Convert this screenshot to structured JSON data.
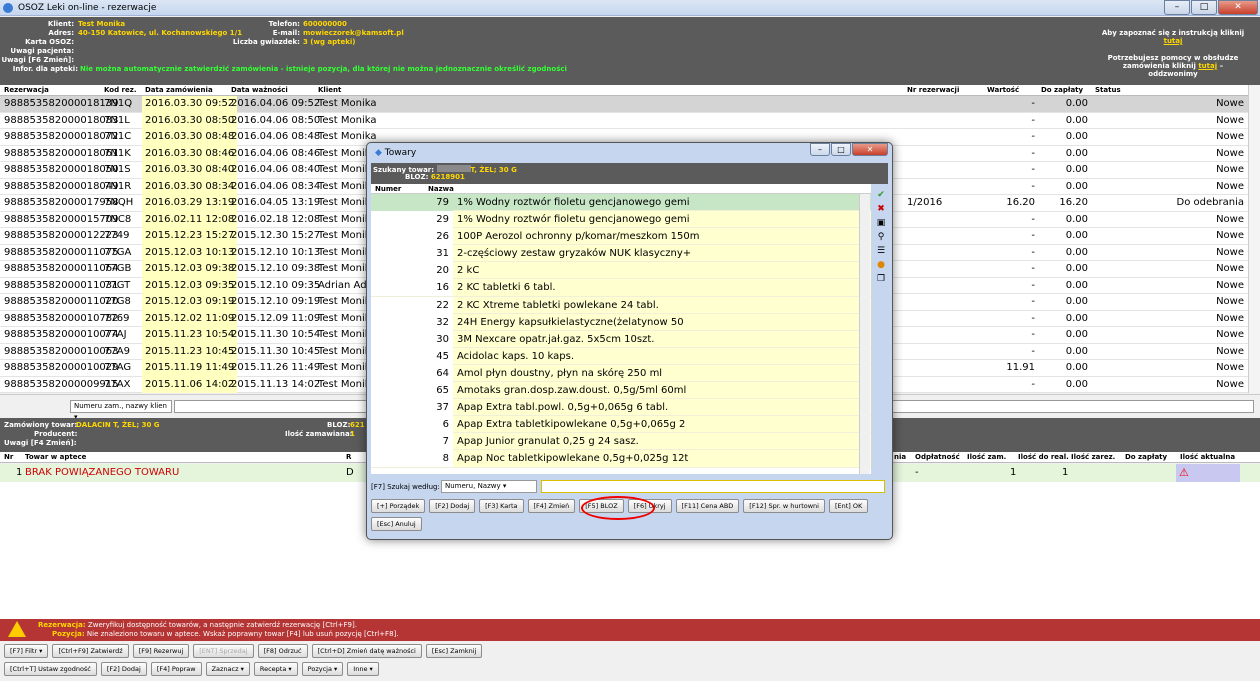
{
  "window": {
    "title": "OSOZ Leki on-line - rezerwacje"
  },
  "header": {
    "labels": {
      "klient": "Klient:",
      "adres": "Adres:",
      "karta": "Karta OSOZ:",
      "uwagi": "Uwagi pacjenta:",
      "uwagi_f6": "Uwagi [F6 Zmień]:",
      "infor": "Infor. dla apteki:",
      "telefon": "Telefon:",
      "email": "E-mail:",
      "liczba": "Liczba gwiazdek:"
    },
    "klient": "Test Monika",
    "adres": "40-150 Katowice, ul. Kochanowskiego 1/1",
    "telefon": "600000000",
    "email": "mowieczorek@kamsoft.pl",
    "liczba": "3 (wg apteki)",
    "infor": "Nie można automatycznie zatwierdzić zamówienia - istnieje pozycja, dla której nie można jednoznacznie określić zgodności",
    "help1": "Aby zapoznać się z instrukcją kliknij",
    "help1_link": "tutaj",
    "help2": "Potrzebujesz pomocy w obsłudze zamówienia kliknij",
    "help2_link": "tutaj",
    "help2_tail": "– oddzwonimy"
  },
  "table": {
    "columns": [
      "Rezerwacja",
      "Kod rez.",
      "Data zamówienia",
      "Data ważności",
      "Klient",
      "Nr rezerwacji",
      "Wartość",
      "Do zapłaty",
      "Status"
    ],
    "rows": [
      [
        "988853582000018139",
        "7N1Q",
        "2016.03.30 09:52",
        "2016.04.06 09:52",
        "Test Monika",
        "",
        "-",
        "0.00",
        "Nowe"
      ],
      [
        "988853582000018083",
        "7N1L",
        "2016.03.30 08:50",
        "2016.04.06 08:50",
        "Test Monika",
        "",
        "-",
        "0.00",
        "Nowe"
      ],
      [
        "988853582000018072",
        "7N1C",
        "2016.03.30 08:48",
        "2016.04.06 08:48",
        "Test Monika",
        "",
        "-",
        "0.00",
        "Nowe"
      ],
      [
        "988853582000018061",
        "7N1K",
        "2016.03.30 08:46",
        "2016.04.06 08:46",
        "Test Monik",
        "",
        "-",
        "0.00",
        "Nowe"
      ],
      [
        "988853582000018050",
        "7N1S",
        "2016.03.30 08:40",
        "2016.04.06 08:40",
        "Test Monik",
        "",
        "-",
        "0.00",
        "Nowe"
      ],
      [
        "988853582000018049",
        "7N1R",
        "2016.03.30 08:34",
        "2016.04.06 08:34",
        "Test Monik",
        "",
        "-",
        "0.00",
        "Nowe"
      ],
      [
        "988853582000017958",
        "7NQH",
        "2016.03.29 13:19",
        "2016.04.05 13:19",
        "Test Monik",
        "1/2016",
        "16.20",
        "16.20",
        "Do odebrania"
      ],
      [
        "988853582000015709",
        "7NC8",
        "2016.02.11 12:08",
        "2016.02.18 12:08",
        "Test Monik",
        "",
        "-",
        "0.00",
        "Nowe"
      ],
      [
        "988853582000012223",
        "7749",
        "2015.12.23 15:27",
        "2015.12.30 15:27",
        "Test Monik",
        "",
        "-",
        "0.00",
        "Nowe"
      ],
      [
        "988853582000011075",
        "77GA",
        "2015.12.03 10:13",
        "2015.12.10 10:13",
        "Test Monik",
        "",
        "-",
        "0.00",
        "Nowe"
      ],
      [
        "988853582000011064",
        "77GB",
        "2015.12.03 09:38",
        "2015.12.10 09:38",
        "Test Monik",
        "",
        "-",
        "0.00",
        "Nowe"
      ],
      [
        "988853582000011031",
        "77GT",
        "2015.12.03 09:35",
        "2015.12.10 09:35",
        "Adrian Adr",
        "",
        "-",
        "0.00",
        "Nowe"
      ],
      [
        "988853582000011020",
        "77G8",
        "2015.12.03 09:19",
        "2015.12.10 09:19",
        "Test Monik",
        "",
        "-",
        "0.00",
        "Nowe"
      ],
      [
        "988853582000010782",
        "7769",
        "2015.12.02 11:09",
        "2015.12.09 11:09",
        "Test Monik",
        "",
        "-",
        "0.00",
        "Nowe"
      ],
      [
        "988853582000010074",
        "77AJ",
        "2015.11.23 10:54",
        "2015.11.30 10:54",
        "Test Monik",
        "",
        "-",
        "0.00",
        "Nowe"
      ],
      [
        "988853582000010063",
        "77A9",
        "2015.11.23 10:45",
        "2015.11.30 10:45",
        "Test Monik",
        "",
        "-",
        "0.00",
        "Nowe"
      ],
      [
        "988853582000010029",
        "77AG",
        "2015.11.19 11:49",
        "2015.11.26 11:49",
        "Test Monik",
        "",
        "11.91",
        "0.00",
        "Nowe"
      ],
      [
        "988853582000009915",
        "77AX",
        "2015.11.06 14:02",
        "2015.11.13 14:02",
        "Test Monik",
        "",
        "-",
        "0.00",
        "Nowe"
      ]
    ]
  },
  "search_combo": "Numeru zam., nazwy klien",
  "bottom": {
    "labels": {
      "towar": "Zamówiony towar:",
      "producent": "Producent:",
      "uwagi": "Uwagi [F4 Zmień]:",
      "bloz": "BLOZ:",
      "ilosc": "Ilość zamawiana:"
    },
    "towar": "DALACIN T, ŻEL; 30 G",
    "bloz": "621",
    "ilosc": "1",
    "columns": [
      "Nr",
      "Towar w aptece",
      "R",
      "nia",
      "Odpłatność",
      "Ilość zam.",
      "Ilość do real.",
      "Ilość zarez.",
      "Do zapłaty",
      "Ilość aktualna"
    ],
    "row": {
      "nr": "1",
      "towar": "BRAK POWIĄZANEGO TOWARU",
      "r": "D",
      "odp": "-",
      "zam": "1",
      "real": "1"
    }
  },
  "alert": {
    "l1_label": "Rezerwacja:",
    "l1": "Zweryfikuj dostępność towarów, a następnie zatwierdź rezerwację [Ctrl+F9].",
    "l2_label": "Pozycja:",
    "l2": "Nie znaleziono towaru w aptece. Wskaż poprawny towar [F4] lub usuń pozycję [Ctrl+F8]."
  },
  "buttons1": [
    "[F7] Filtr ▾",
    "[Ctrl+F9] Zatwierdź",
    "[F9] Rezerwuj",
    "[ENT] Sprzedaj",
    "[F8] Odrzuć",
    "[Ctrl+D] Zmień datę ważności",
    "[Esc] Zamknij"
  ],
  "buttons2": [
    "[Ctrl+T] Ustaw zgodność",
    "[F2] Dodaj",
    "[F4] Popraw",
    "Zaznacz ▾",
    "Recepta ▾",
    "Pozycja ▾",
    "Inne ▾"
  ],
  "dialog": {
    "title": "Towary",
    "szukany_label": "Szukany towar:",
    "szukany": "T, ŻEL; 30 G",
    "bloz_label": "BLOZ:",
    "bloz": "6218901",
    "col_num": "Numer",
    "col_name": "Nazwa",
    "items": [
      [
        "79",
        "1% Wodny roztwór fioletu gencjanowego gemi"
      ],
      [
        "29",
        "1% Wodny roztwór fioletu gencjanowego gemi"
      ],
      [
        "26",
        "100P Aerozol ochronny p/komar/meszkom 150m"
      ],
      [
        "31",
        "2-częściowy zestaw gryzaków NUK klasyczny+"
      ],
      [
        "20",
        "2 kC"
      ],
      [
        "16",
        "2 KC tabletki 6 tabl."
      ],
      [
        "22",
        "2 KC Xtreme tabletki powlekane 24 tabl."
      ],
      [
        "32",
        "24H Energy kapsułkielastyczne(żelatynow 50"
      ],
      [
        "30",
        "3M Nexcare opatr.jał.gaz. 5x5cm 10szt."
      ],
      [
        "45",
        "Acidolac kaps. 10 kaps."
      ],
      [
        "64",
        "Amol płyn doustny, płyn na skórę 250 ml"
      ],
      [
        "65",
        "Amotaks gran.dosp.zaw.doust. 0,5g/5ml 60ml"
      ],
      [
        "37",
        "Apap Extra tabl.powl. 0,5g+0,065g 6 tabl."
      ],
      [
        "6",
        "Apap Extra tabletkipowlekane 0,5g+0,065g 2"
      ],
      [
        "7",
        "Apap Junior granulat 0,25 g 24 sasz."
      ],
      [
        "8",
        "Apap Noc tabletkipowlekane 0,5g+0,025g 12t"
      ]
    ],
    "search_label": "[F7] Szukaj według:",
    "search_by": "Numeru, Nazwy",
    "buttons": [
      "[+] Porządek",
      "[F2] Dodaj",
      "[F3] Karta",
      "[F4] Zmień",
      "[F5] BLOZ",
      "[F6] Ukryj",
      "[F11] Cena ABD",
      "[F12] Spr. w hurtowni",
      "[Ent] OK",
      "[Esc] Anuluj"
    ]
  }
}
